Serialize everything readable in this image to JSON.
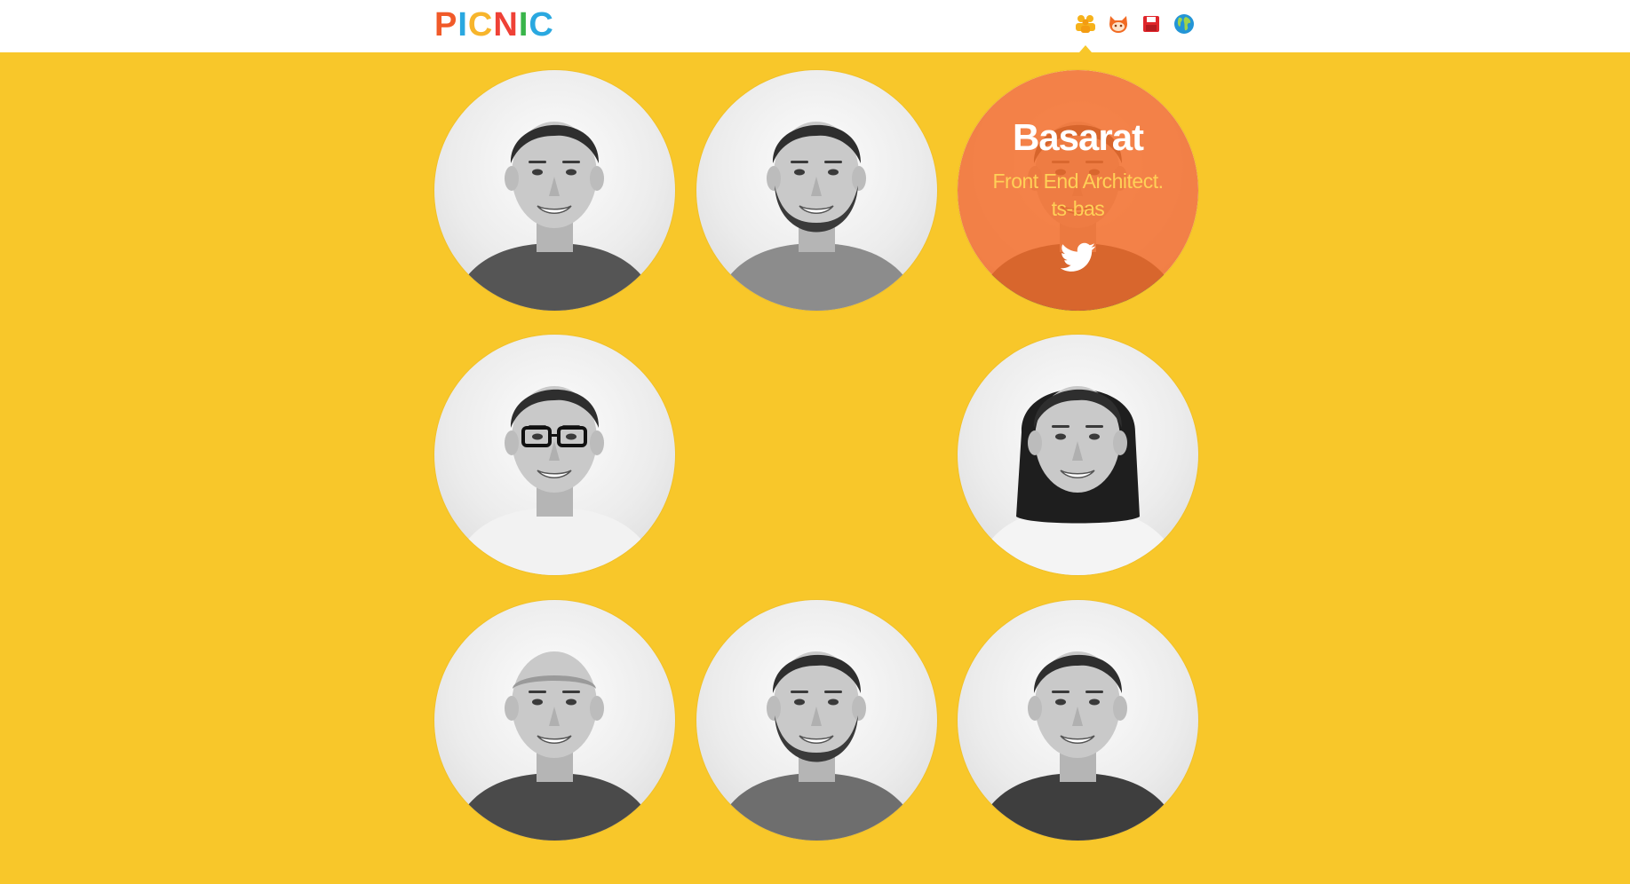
{
  "header": {
    "logo_letters": [
      "P",
      "I",
      "C",
      "N",
      "I",
      "C"
    ],
    "logo_colors": [
      "#f15a29",
      "#2aa8e0",
      "#f7b52c",
      "#ef4136",
      "#39b54a",
      "#2aa8e0"
    ],
    "nav": [
      {
        "icon": "team-icon",
        "color": "#f6b21b"
      },
      {
        "icon": "github-cat-icon",
        "color": "#f26b23"
      },
      {
        "icon": "floppy-disk-icon",
        "color": "#e0262b"
      },
      {
        "icon": "globe-icon",
        "color": "#2395d6"
      }
    ]
  },
  "colors": {
    "background": "#f8c72a",
    "overlay": "#f36f2c",
    "overlay_text": "#ffd057"
  },
  "people": [
    {
      "slot": "row1-col1",
      "shirt": "#555555"
    },
    {
      "slot": "row1-col2",
      "shirt": "#8c8c8c",
      "beard": true
    },
    {
      "slot": "row1-col3",
      "shirt": "#333333",
      "overlay": {
        "name": "Basarat",
        "role": "Front End Architect.",
        "handle": "ts-bas",
        "icon": "twitter-bird-icon"
      }
    },
    {
      "slot": "row2-col1",
      "shirt": "#f2f2f2",
      "glasses": true
    },
    {
      "slot": "row2-col2",
      "empty": true
    },
    {
      "slot": "row2-col3",
      "shirt": "#f4f4f4",
      "long_hair": true
    },
    {
      "slot": "row3-col1",
      "shirt": "#4a4a4a",
      "bald": true
    },
    {
      "slot": "row3-col2",
      "shirt": "#6e6e6e",
      "beard": true
    },
    {
      "slot": "row3-col3",
      "shirt": "#3e3e3e"
    }
  ]
}
